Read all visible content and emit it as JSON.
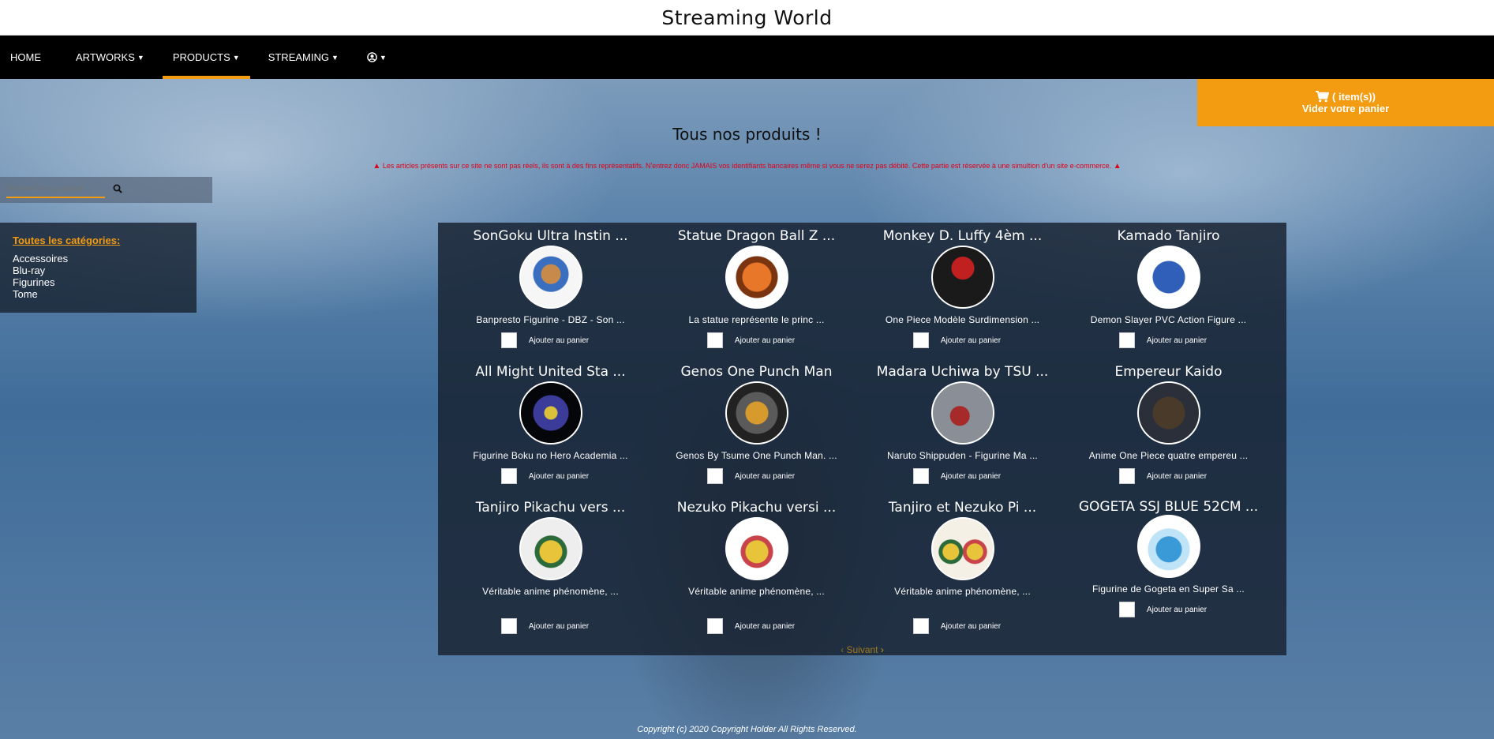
{
  "site": {
    "title": "Streaming World"
  },
  "nav": {
    "items": [
      {
        "label": "HOME",
        "has_caret": false
      },
      {
        "label": "ARTWORKS",
        "has_caret": true
      },
      {
        "label": "PRODUCTS",
        "has_caret": true,
        "active": true
      },
      {
        "label": "STREAMING",
        "has_caret": true
      }
    ],
    "account_icon": "user-circle-icon"
  },
  "cart": {
    "count_label": "( item(s))",
    "clear_label": "Vider votre panier",
    "icon": "cart-icon"
  },
  "page": {
    "heading": "Tous nos produits !",
    "warning": "Les articles présents sur ce site ne sont pas réels, ils sont à des fins représentatifs. N'entrez donc JAMAIS vos identifiants bancaires même si vous ne serez pas débité. Cette partie est réservée à une simultion d'un site e-commerce."
  },
  "search": {
    "placeholder": "Rechercher un produit"
  },
  "categories": {
    "title": "Toutes les catégories:",
    "items": [
      "Accessoires",
      "Blu-ray",
      "Figurines",
      "Tome"
    ]
  },
  "products": [
    {
      "name": "SonGoku Ultra Instin ...",
      "desc": "Banpresto Figurine - DBZ - Son ...",
      "add_label": "Ajouter au panier"
    },
    {
      "name": "Statue Dragon Ball Z ...",
      "desc": "La statue représente le princ ...",
      "add_label": "Ajouter au panier"
    },
    {
      "name": "Monkey D. Luffy 4èm ...",
      "desc": "One Piece Modèle Surdimension ...",
      "add_label": "Ajouter au panier"
    },
    {
      "name": "Kamado Tanjiro",
      "desc": "Demon Slayer PVC Action Figure ...",
      "add_label": "Ajouter au panier"
    },
    {
      "name": "All Might United Sta ...",
      "desc": "Figurine Boku no Hero Academia ...",
      "add_label": "Ajouter au panier"
    },
    {
      "name": "Genos One Punch Man",
      "desc": "Genos By Tsume One Punch Man. ...",
      "add_label": "Ajouter au panier"
    },
    {
      "name": "Madara Uchiwa by TSU ...",
      "desc": "Naruto Shippuden - Figurine Ma ...",
      "add_label": "Ajouter au panier"
    },
    {
      "name": "Empereur Kaido",
      "desc": "Anime One Piece quatre empereu ...",
      "add_label": "Ajouter au panier"
    },
    {
      "name": "Tanjiro Pikachu vers ...",
      "desc": "Véritable anime phénomène, ...",
      "add_label": "Ajouter au panier"
    },
    {
      "name": "Nezuko Pikachu versi ...",
      "desc": "Véritable anime phénomène, ...",
      "add_label": "Ajouter au panier"
    },
    {
      "name": "Tanjiro et Nezuko Pi ...",
      "desc": "Véritable anime phénomène, ...",
      "add_label": "Ajouter au panier"
    },
    {
      "name": "GOGETA SSJ BLUE 52CM ...",
      "desc": "Figurine de Gogeta en Super Sa ...",
      "add_label": "Ajouter au panier"
    }
  ],
  "pager": {
    "next_label": "Suivant"
  },
  "footer": {
    "copyright": "Copyright (c) 2020 Copyright Holder All Rights Reserved."
  }
}
